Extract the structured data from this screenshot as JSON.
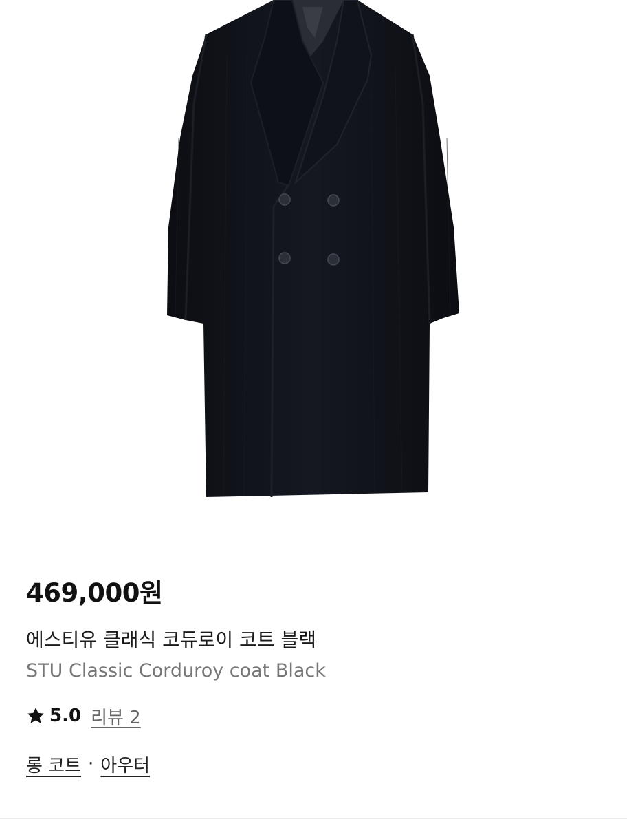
{
  "product": {
    "image_alt": "STU Classic Corduroy coat Black",
    "price": "469,000원",
    "title_ko": "에스티유 클래식 코듀로이 코트 블랙",
    "title_en": "STU Classic Corduroy coat Black"
  },
  "rating": {
    "icon": "star-icon",
    "value": "5.0",
    "review_label": "리뷰 2"
  },
  "categories": {
    "items": [
      {
        "label": "롱 코트"
      },
      {
        "label": "아우터"
      }
    ],
    "separator": "·"
  },
  "colors": {
    "coat": "#111419",
    "price_text": "#111111",
    "subtitle_text": "#777777"
  }
}
